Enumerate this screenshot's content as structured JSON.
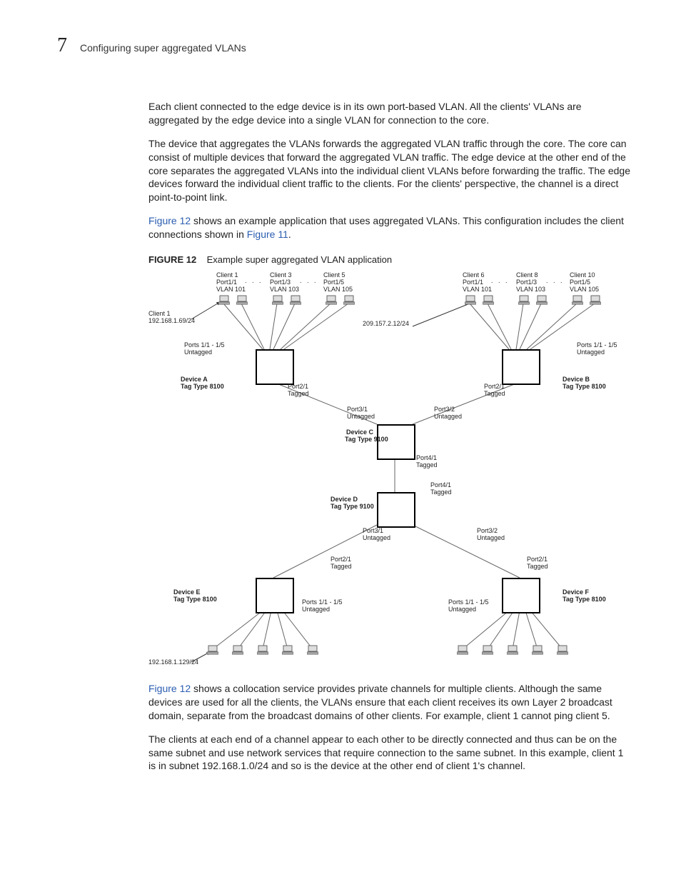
{
  "header": {
    "num": "7",
    "title": "Configuring super aggregated VLANs"
  },
  "p1": "Each client connected to the edge device is in its own port-based VLAN. All the clients' VLANs are aggregated by the edge device into a single VLAN for connection to the core.",
  "p2": "The device that aggregates the VLANs forwards the aggregated VLAN traffic through the core. The core can consist of multiple devices that forward the aggregated VLAN traffic. The edge device at the other end of the core separates the aggregated VLANs into the individual client VLANs before forwarding the traffic. The edge devices forward the individual client traffic to the clients. For the clients' perspective, the channel is a direct point-to-point link.",
  "p3a": "Figure 12",
  "p3b": " shows an example application that uses aggregated VLANs. This configuration includes the client connections shown in ",
  "p3c": "Figure 11",
  "p3d": ".",
  "figcap": {
    "label": "FIGURE 12",
    "text": "Example super aggregated VLAN application"
  },
  "diagram": {
    "top_left": {
      "c1": "Client 1\nPort1/1\nVLAN 101",
      "c2": "Client 3\nPort1/3\nVLAN 103",
      "c3": "Client 5\nPort1/5\nVLAN 105"
    },
    "top_right": {
      "c1": "Client 6\nPort1/1\nVLAN 101",
      "c2": "Client 8\nPort1/3\nVLAN 103",
      "c3": "Client 10\nPort1/5\nVLAN 105"
    },
    "ip_left": "Client 1\n192.168.1.69/24",
    "ip_mid": "209.157.2.12/24",
    "ports_left": "Ports 1/1 - 1/5\nUntagged",
    "ports_right": "Ports 1/1 - 1/5\nUntagged",
    "devA": "Device A\nTag Type 8100",
    "devB": "Device B\nTag Type 8100",
    "p21t_l": "Port2/1\nTagged",
    "p21t_r": "Port2/1\nTagged",
    "p31u": "Port3/1\nUntagged",
    "p32u": "Port3/2\nUntagged",
    "devC": "Device C\nTag Type 9100",
    "p41t": "Port4/1\nTagged",
    "p41t2": "Port4/1\nTagged",
    "devD": "Device D\nTag Type 9100",
    "p31u2": "Port3/1\nUntagged",
    "p32u2": "Port3/2\nUntagged",
    "p21t_bl": "Port2/1\nTagged",
    "p21t_br": "Port2/1\nTagged",
    "devE": "Device E\nTag Type 8100",
    "devF": "Device F\nTag Type 8100",
    "ports_bl": "Ports 1/1 - 1/5\nUntagged",
    "ports_br": "Ports 1/1 - 1/5\nUntagged",
    "ip_bot": "192.168.1.129/24"
  },
  "p4a": "Figure 12",
  "p4b": " shows a collocation service provides private channels for multiple clients. Although the same devices are used for all the clients, the VLANs ensure that each client receives its own Layer 2 broadcast domain, separate from the broadcast domains of other clients. For example, client 1 cannot ping client 5.",
  "p5": "The clients at each end of a channel appear to each other to be directly connected and thus can be on the same subnet and use network services that require connection to the same subnet. In this example, client 1 is in subnet 192.168.1.0/24 and so is the device at the other end of client 1's channel."
}
